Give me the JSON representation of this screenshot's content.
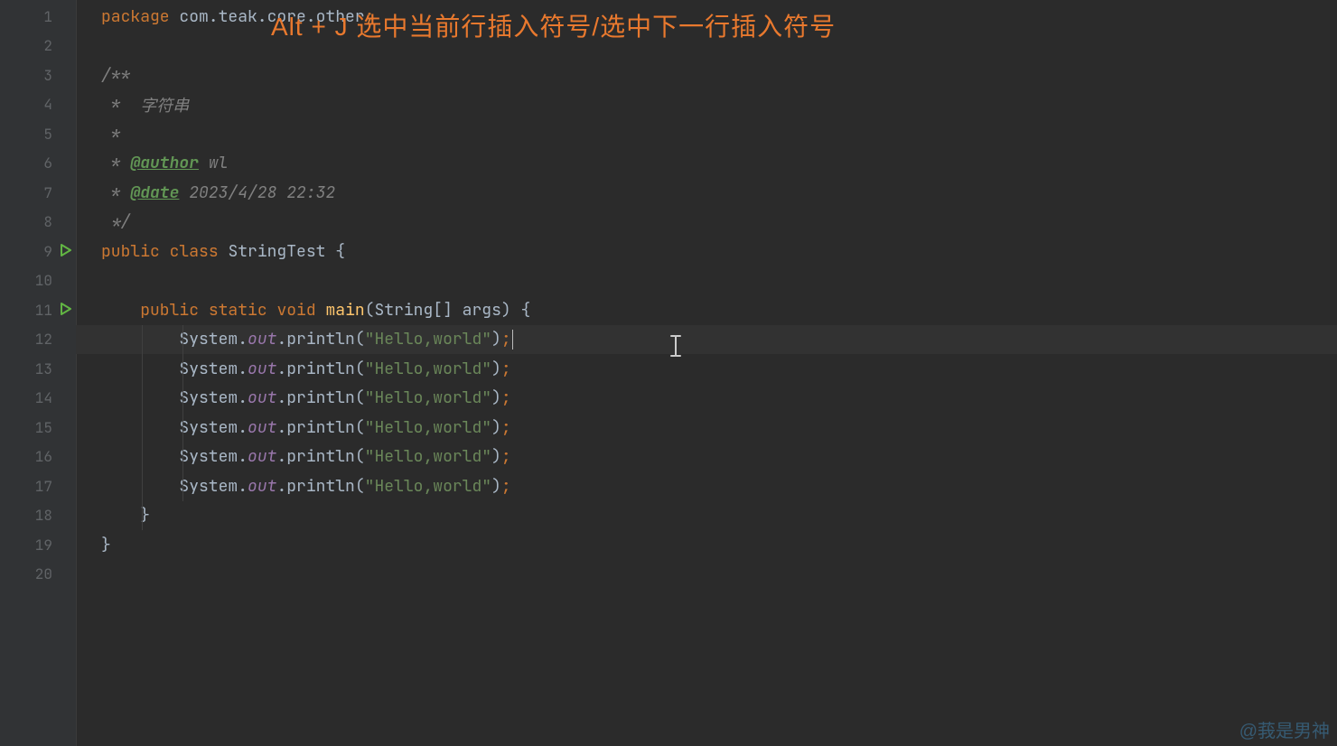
{
  "overlay": {
    "text": "Alt + J 选中当前行插入符号/选中下一行插入符号"
  },
  "watermark": "@莪是男神",
  "gutter": {
    "lines": [
      "1",
      "2",
      "3",
      "4",
      "5",
      "6",
      "7",
      "8",
      "9",
      "10",
      "11",
      "12",
      "13",
      "14",
      "15",
      "16",
      "17",
      "18",
      "19",
      "20"
    ],
    "run_icons_at": [
      9,
      11
    ]
  },
  "code": {
    "package_kw": "package",
    "package_name": " com.teak.core.other",
    "semicolon": ";",
    "doc_open": "/**",
    "doc_star": " * ",
    "doc_star_plain": " *",
    "doc_desc": " 字符串",
    "doc_author_tag": "@author",
    "doc_author_val": " wl",
    "doc_date_tag": "@date",
    "doc_date_val": " 2023/4/28 22:32",
    "doc_close": " */",
    "public_kw": "public",
    "class_kw": "class",
    "static_kw": "static",
    "void_kw": "void",
    "class_name": "StringTest",
    "main_name": "main",
    "main_params_open": "(",
    "string_arr": "String[] args",
    "main_params_close": ")",
    "lbrace": "{",
    "rbrace": "}",
    "sys": "System",
    "dot": ".",
    "out": "out",
    "println": "println",
    "paren_open": "(",
    "paren_close": ")",
    "hello": "\"Hello,world\"",
    "indent1": "    ",
    "indent2": "        "
  },
  "colors": {
    "keyword": "#cc7832",
    "string": "#6a8759",
    "comment": "#808080",
    "field": "#9876aa",
    "method": "#ffc66d",
    "overlay": "#e9792e"
  }
}
